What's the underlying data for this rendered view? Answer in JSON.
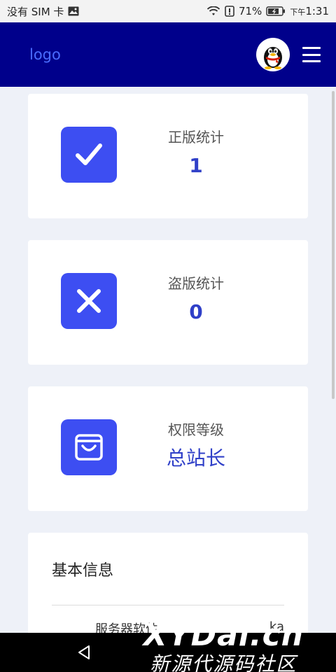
{
  "status_bar": {
    "carrier": "没有 SIM 卡",
    "battery": "71%",
    "time_prefix": "下午",
    "time": "1:31"
  },
  "header": {
    "logo": "logo",
    "avatar_icon": "qq-penguin-icon",
    "menu_icon": "hamburger-menu-icon"
  },
  "stats": [
    {
      "label": "正版统计",
      "value": "1",
      "icon": "checkmark-icon"
    },
    {
      "label": "盗版统计",
      "value": "0",
      "icon": "close-x-icon"
    },
    {
      "label": "权限等级",
      "value": "总站长",
      "icon": "shopping-bag-icon"
    }
  ],
  "info": {
    "title": "基本信息",
    "rows": [
      {
        "label": "服务器软件",
        "value": "ka"
      }
    ]
  },
  "watermark": {
    "line1": "XYDai.cn",
    "line2": "新源代源码社区"
  },
  "colors": {
    "header_bg": "#00008b",
    "accent": "#3d4ef2",
    "value_text": "#3040c8",
    "page_bg": "#eef1f8"
  }
}
